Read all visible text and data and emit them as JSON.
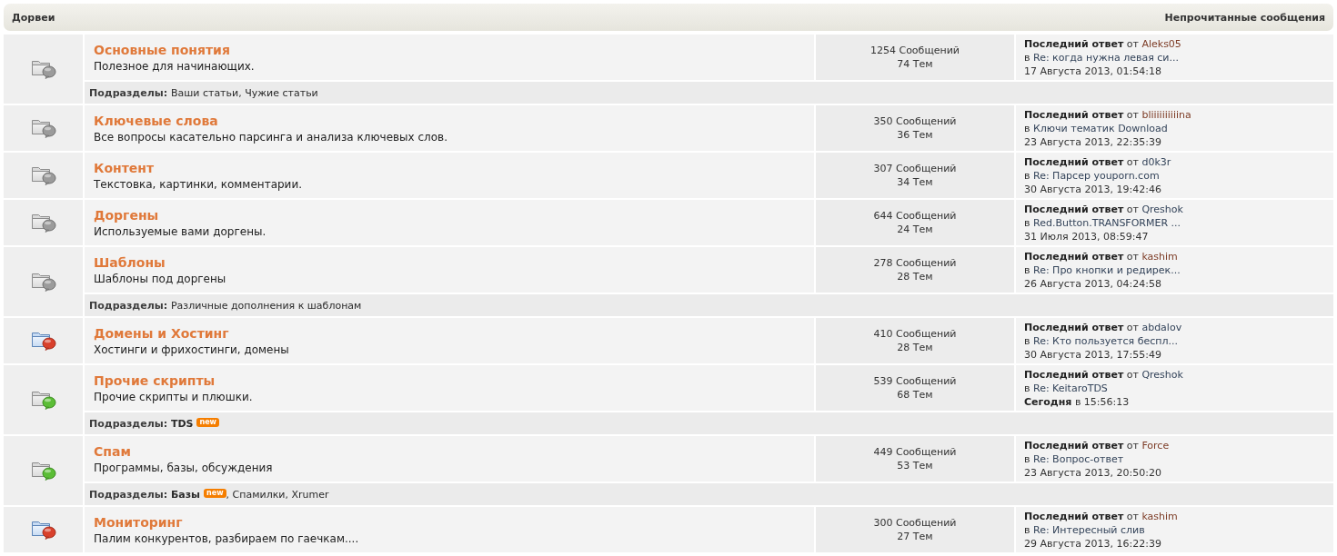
{
  "category": {
    "title": "Дорвеи",
    "unread_link": "Непрочитанные сообщения"
  },
  "forums": [
    {
      "unread": false,
      "subforum_unread": false,
      "title": "Основные понятия",
      "description": "Полезное для начинающих.",
      "posts": "1254 Сообщений",
      "topics": "74 Тем",
      "last_post": {
        "label": "**Последний ответ** от",
        "author": "Aleks05",
        "color": "#7d3c26",
        "prefix": "в",
        "topic": "Re: когда нужна левая си...",
        "date": "17 Августа 2013, 01:54:18"
      },
      "subforums": {
        "label": "Подразделы:",
        "separator": ", ",
        "items": [
          {
            "name": "Ваши статьи",
            "unread": false
          },
          {
            "name": "Чужие статьи",
            "unread": false
          }
        ]
      }
    },
    {
      "unread": false,
      "subforum_unread": false,
      "title": "Ключевые слова",
      "description": "Все вопросы касательно парсинга и анализа ключевых слов.",
      "posts": "350 Сообщений",
      "topics": "36 Тем",
      "last_post": {
        "label": "**Последний ответ** от",
        "author": "bliiiiiiiiiina",
        "color": "#7d3c26",
        "prefix": "в",
        "topic": "Ключи тематик Download",
        "date": "23 Августа 2013, 22:35:39"
      }
    },
    {
      "unread": false,
      "subforum_unread": false,
      "title": "Контент",
      "description": "Текстовка, картинки, комментарии.",
      "posts": "307 Сообщений",
      "topics": "34 Тем",
      "last_post": {
        "label": "**Последний ответ** от",
        "author": "d0k3r",
        "color": "#34445a",
        "prefix": "в",
        "topic": "Re: Парсер youporn.com",
        "date": "30 Августа 2013, 19:42:46"
      }
    },
    {
      "unread": false,
      "subforum_unread": false,
      "title": "Доргены",
      "description": "Используемые вами доргены.",
      "posts": "644 Сообщений",
      "topics": "24 Тем",
      "last_post": {
        "label": "**Последний ответ** от",
        "author": "Qreshok",
        "color": "#34445a",
        "prefix": "в",
        "topic": "Red.Button.TRANSFORMER ...",
        "date": "31 Июля 2013, 08:59:47"
      }
    },
    {
      "unread": false,
      "subforum_unread": false,
      "title": "Шаблоны",
      "description": "Шаблоны под доргены",
      "posts": "278 Сообщений",
      "topics": "28 Тем",
      "last_post": {
        "label": "**Последний ответ** от",
        "author": "kashim",
        "color": "#7d3c26",
        "prefix": "в",
        "topic": "Re: Про кнопки и редирек...",
        "date": "26 Августа 2013, 04:24:58"
      },
      "subforums": {
        "label": "Подразделы:",
        "items": [
          {
            "name": "Различные дополнения к шаблонам",
            "unread": false
          }
        ]
      }
    },
    {
      "unread": true,
      "subforum_unread": false,
      "title": "Домены и Хостинг",
      "description": "Хостинги и фрихостинги, домены",
      "posts": "410 Сообщений",
      "topics": "28 Тем",
      "last_post": {
        "label": "**Последний ответ** от",
        "author": "abdalov",
        "color": "#34445a",
        "prefix": "в",
        "topic": "Re: Кто пользуется беспл...",
        "date": "30 Августа 2013, 17:55:49"
      }
    },
    {
      "unread": false,
      "subforum_unread": true,
      "title": "Прочие скрипты",
      "description": "Прочие скрипты и плюшки.",
      "posts": "539 Сообщений",
      "topics": "68 Тем",
      "last_post": {
        "label": "**Последний ответ** от",
        "author": "Qreshok",
        "color": "#34445a",
        "prefix": "в",
        "topic": "Re: KeitaroTDS",
        "date": "**Сегодня** в 15:56:13"
      },
      "subforums": {
        "label": "Подразделы:",
        "items": [
          {
            "name": "TDS",
            "unread": true,
            "badge": "new"
          }
        ]
      }
    },
    {
      "unread": false,
      "subforum_unread": true,
      "title": "Спам",
      "description": "Программы, базы, обсуждения",
      "posts": "449 Сообщений",
      "topics": "53 Тем",
      "last_post": {
        "label": "**Последний ответ** от",
        "author": "Force",
        "color": "#7d3c26",
        "prefix": "в",
        "topic": "Re: Вопрос-ответ",
        "date": "23 Августа 2013, 20:50:20"
      },
      "subforums": {
        "label": "Подразделы:",
        "separator": ", ",
        "items": [
          {
            "name": "Базы",
            "unread": true,
            "badge": "new"
          },
          {
            "name": "Спамилки",
            "unread": false
          },
          {
            "name": "Xrumer",
            "unread": false
          }
        ]
      }
    },
    {
      "unread": true,
      "subforum_unread": false,
      "title": "Мониторинг",
      "description": "Палим конкурентов, разбираем по гаечкам....",
      "posts": "300 Сообщений",
      "topics": "27 Тем",
      "last_post": {
        "label": "**Последний ответ** от",
        "author": "kashim",
        "color": "#7d3c26",
        "prefix": "в",
        "topic": "Re: Интересный слив",
        "date": "29 Августа 2013, 16:22:39"
      }
    }
  ]
}
